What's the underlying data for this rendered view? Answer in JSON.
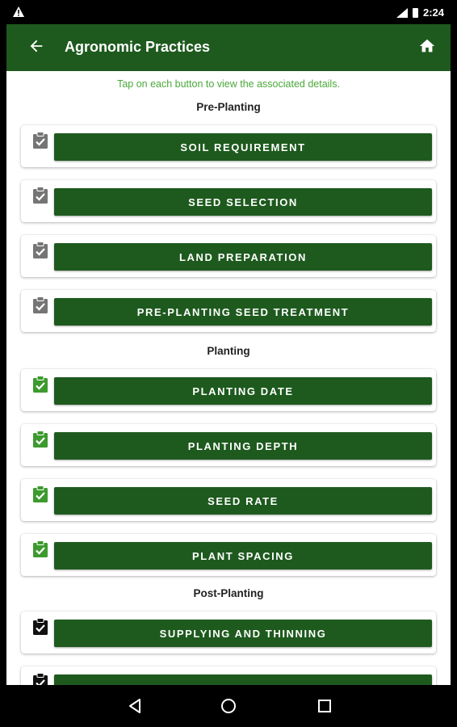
{
  "statusbar": {
    "time": "2:24",
    "warning_icon": "warning-icon",
    "signal_icon": "signal-icon",
    "battery_icon": "battery-icon"
  },
  "appbar": {
    "title": "Agronomic Practices",
    "back_icon": "arrow-back-icon",
    "home_icon": "home-icon"
  },
  "hint": "Tap on each button to view the associated details.",
  "colors": {
    "primary": "#1e5a1e",
    "hint": "#4aa83a",
    "clip_grey": "#757575",
    "clip_green": "#3d9a2e",
    "clip_black": "#111111"
  },
  "sections": [
    {
      "title": "Pre-Planting",
      "items": [
        {
          "label": "SOIL REQUIREMENT",
          "clip": "grey"
        },
        {
          "label": "SEED SELECTION",
          "clip": "grey"
        },
        {
          "label": "LAND PREPARATION",
          "clip": "grey"
        },
        {
          "label": "PRE-PLANTING SEED TREATMENT",
          "clip": "grey"
        }
      ]
    },
    {
      "title": "Planting",
      "items": [
        {
          "label": "PLANTING DATE",
          "clip": "green"
        },
        {
          "label": "PLANTING DEPTH",
          "clip": "green"
        },
        {
          "label": "SEED RATE",
          "clip": "green"
        },
        {
          "label": "PLANT SPACING",
          "clip": "green"
        }
      ]
    },
    {
      "title": "Post-Planting",
      "items": [
        {
          "label": "SUPPLYING AND THINNING",
          "clip": "black"
        },
        {
          "label": "",
          "clip": "black"
        }
      ]
    }
  ],
  "navbar": {
    "back_icon": "nav-back-icon",
    "home_icon": "nav-home-icon",
    "recents_icon": "nav-recents-icon"
  }
}
